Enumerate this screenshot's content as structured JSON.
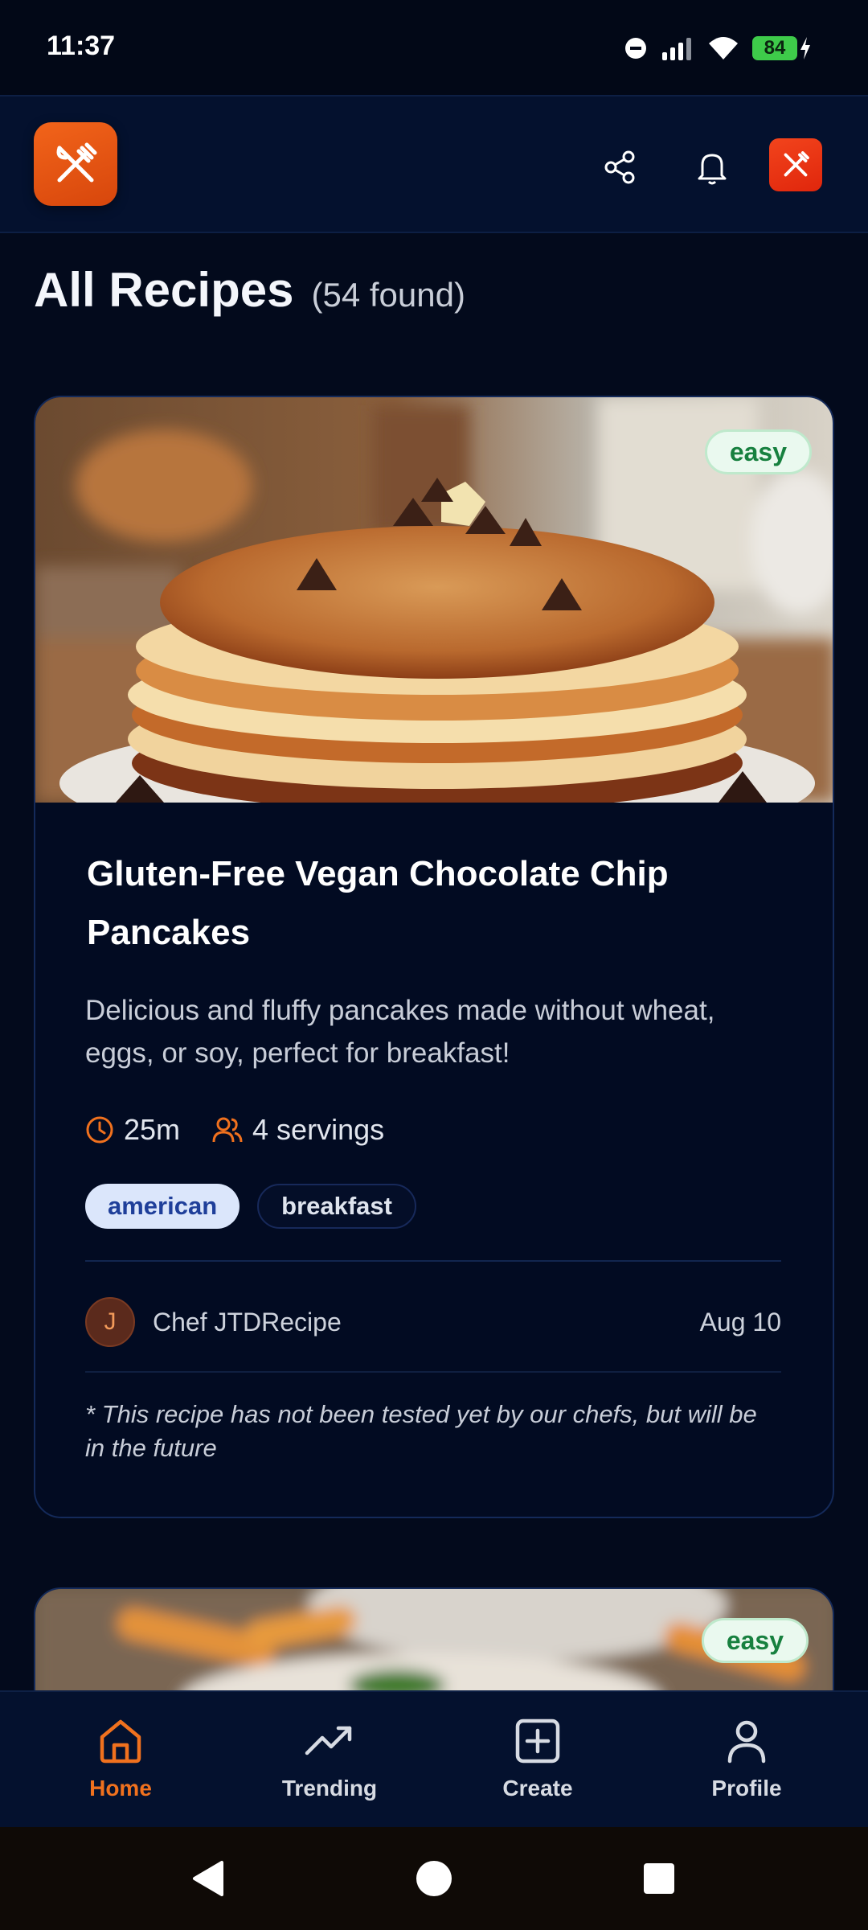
{
  "status_bar": {
    "time": "11:37",
    "battery": "84"
  },
  "header": {
    "logo_icon": "utensils-crossed-icon",
    "share_icon": "share-icon",
    "bell_icon": "bell-icon",
    "avatar_icon": "utensils-crossed-icon"
  },
  "page": {
    "title": "All Recipes",
    "found": "(54 found)"
  },
  "recipe": {
    "difficulty": "easy",
    "title": "Gluten-Free Vegan Chocolate Chip Pancakes",
    "description": "Delicious and fluffy pancakes made without wheat, eggs, or soy, perfect for breakfast!",
    "time": "25m",
    "servings": "4 servings",
    "tags": [
      "american",
      "breakfast"
    ],
    "author_initial": "J",
    "author": "Chef JTDRecipe",
    "date": "Aug 10",
    "disclaimer": "* This recipe has not been tested yet by our chefs, but will be in the future"
  },
  "recipe_2": {
    "difficulty": "easy"
  },
  "nav": {
    "items": [
      {
        "label": "Home",
        "icon": "home-icon",
        "active": true
      },
      {
        "label": "Trending",
        "icon": "trending-up-icon",
        "active": false
      },
      {
        "label": "Create",
        "icon": "plus-square-icon",
        "active": false
      },
      {
        "label": "Profile",
        "icon": "user-icon",
        "active": false
      }
    ]
  },
  "colors": {
    "accent": "#f0711e",
    "background": "#030a1c",
    "badge_green": "#17803f"
  }
}
